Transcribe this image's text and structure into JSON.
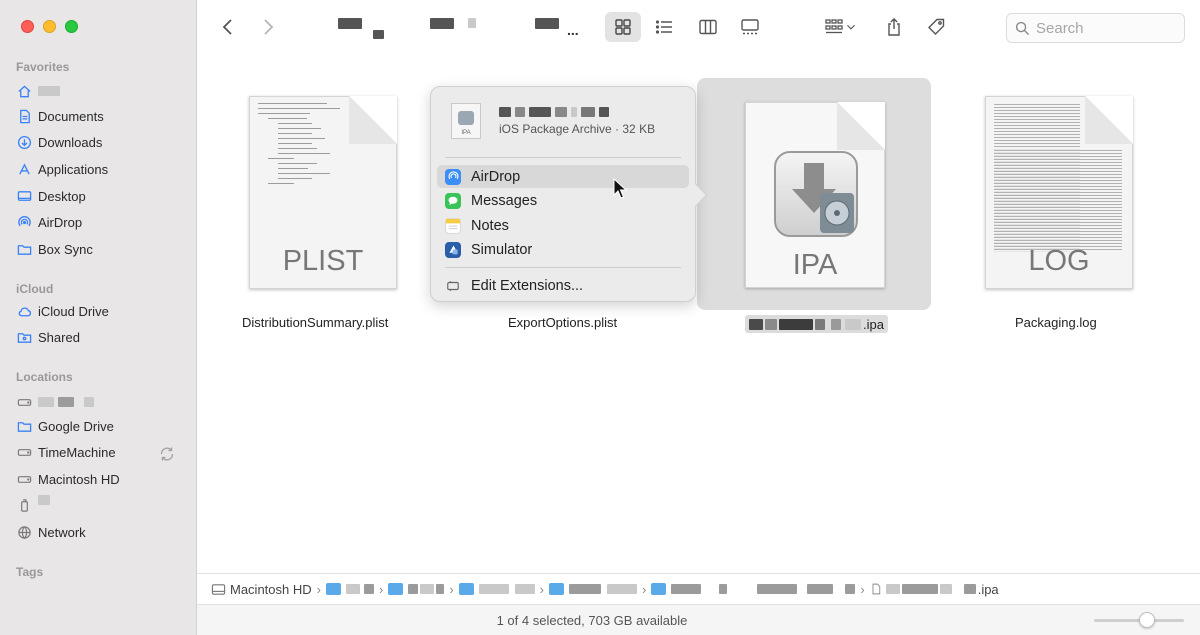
{
  "window": {
    "title": ""
  },
  "sidebar": {
    "favorites_title": "Favorites",
    "favorites": [
      {
        "label": "",
        "icon": "home-icon"
      },
      {
        "label": "Documents",
        "icon": "document-icon"
      },
      {
        "label": "Downloads",
        "icon": "download-icon"
      },
      {
        "label": "Applications",
        "icon": "applications-icon"
      },
      {
        "label": "Desktop",
        "icon": "desktop-icon"
      },
      {
        "label": "AirDrop",
        "icon": "airdrop-icon"
      },
      {
        "label": "Box Sync",
        "icon": "folder-icon"
      }
    ],
    "icloud_title": "iCloud",
    "icloud": [
      {
        "label": "iCloud Drive",
        "icon": "cloud-icon"
      },
      {
        "label": "Shared",
        "icon": "shared-folder-icon"
      }
    ],
    "locations_title": "Locations",
    "locations": [
      {
        "label": "",
        "icon": "disk-icon"
      },
      {
        "label": "Google Drive",
        "icon": "folder-icon"
      },
      {
        "label": "TimeMachine",
        "icon": "disk-icon"
      },
      {
        "label": "Macintosh HD",
        "icon": "disk-icon"
      },
      {
        "label": "",
        "icon": "usb-icon"
      },
      {
        "label": "Network",
        "icon": "globe-icon"
      }
    ],
    "tags_title": "Tags"
  },
  "toolbar": {
    "search_placeholder": "Search"
  },
  "files": [
    {
      "name": "DistributionSummary.plist",
      "label": "PLIST"
    },
    {
      "name": "ExportOptions.plist",
      "label": ""
    },
    {
      "name": ".ipa",
      "label": "IPA"
    },
    {
      "name": "Packaging.log",
      "label": "LOG"
    }
  ],
  "share_menu": {
    "file_kind": "iOS Package Archive · 32 KB",
    "file_icon_text": "IPA",
    "items": [
      {
        "label": "AirDrop",
        "icon": "airdrop-icon"
      },
      {
        "label": "Messages",
        "icon": "messages-icon"
      },
      {
        "label": "Notes",
        "icon": "notes-icon"
      },
      {
        "label": "Simulator",
        "icon": "simulator-icon"
      }
    ],
    "edit_label": "Edit Extensions..."
  },
  "pathbar": {
    "root": "Macintosh HD",
    "last": ".ipa"
  },
  "status": {
    "text": "1 of 4 selected, 703 GB available"
  },
  "colors": {
    "accent": "#3a82f7",
    "sidebar_bg": "#e8e6e6",
    "selection": "#dddddd"
  }
}
